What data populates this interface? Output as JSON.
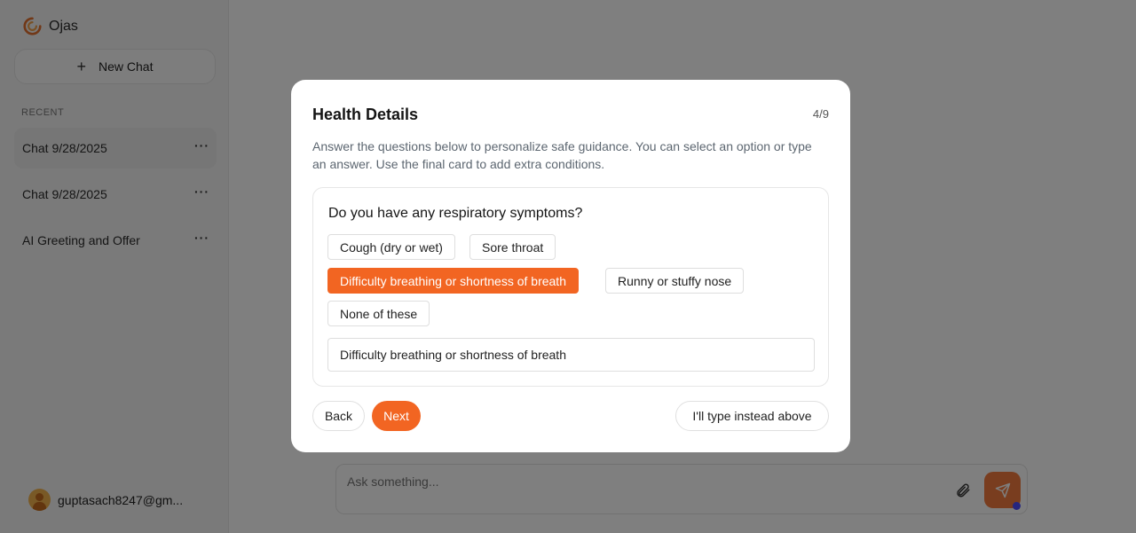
{
  "app": {
    "name": "Ojas"
  },
  "sidebar": {
    "new_chat_label": "New Chat",
    "recent_label": "RECENT",
    "items": [
      {
        "label": "Chat 9/28/2025",
        "active": true
      },
      {
        "label": "Chat 9/28/2025",
        "active": false
      },
      {
        "label": "AI Greeting and Offer",
        "active": false
      }
    ],
    "more_glyph": "···",
    "user_email": "guptasach8247@gm..."
  },
  "composer": {
    "placeholder": "Ask something..."
  },
  "modal": {
    "title": "Health Details",
    "step": "4/9",
    "description": "Answer the questions below to personalize safe guidance. You can select an option or type an answer. Use the final card to add extra conditions.",
    "question": "Do you have any respiratory symptoms?",
    "options": [
      {
        "label": "Cough (dry or wet)",
        "selected": false
      },
      {
        "label": "Sore throat",
        "selected": false
      },
      {
        "label": "Difficulty breathing or shortness of breath",
        "selected": true
      },
      {
        "label": "Runny or stuffy nose",
        "selected": false
      },
      {
        "label": "None of these",
        "selected": false
      }
    ],
    "answer_value": "Difficulty breathing or shortness of breath",
    "back_label": "Back",
    "next_label": "Next",
    "type_instead_label": "I'll type instead above"
  },
  "colors": {
    "accent": "#f26522",
    "send_button": "#f27a3e",
    "overlay": "rgba(0,0,0,0.5)"
  },
  "icons": [
    "ojas-logo-icon",
    "plus-icon",
    "more-dots-icon",
    "avatar",
    "paperclip-icon",
    "send-icon"
  ]
}
